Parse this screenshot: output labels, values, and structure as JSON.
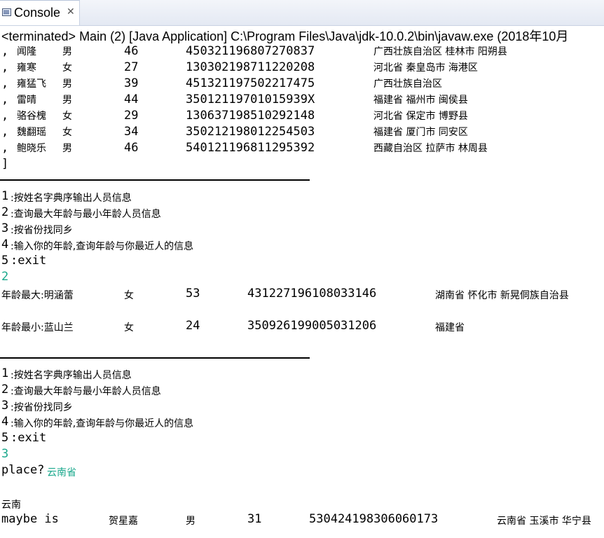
{
  "tab": {
    "label": "Console",
    "close": "✕",
    "icon": "console-icon"
  },
  "status_line": "<terminated> Main (2) [Java Application] C:\\Program Files\\Java\\jdk-10.0.2\\bin\\javaw.exe (2018年10月",
  "people": [
    {
      "prefix": ",",
      "name": "闻隆",
      "gender": "男",
      "age": "46",
      "id": "450321196807270837",
      "region": "广西壮族自治区 桂林市 阳朔县"
    },
    {
      "prefix": ",",
      "name": "雍寒",
      "gender": "女",
      "age": "27",
      "id": "130302198711220208",
      "region": "河北省 秦皇岛市 海港区"
    },
    {
      "prefix": ",",
      "name": "雍猛飞",
      "gender": "男",
      "age": "39",
      "id": "451321197502217475",
      "region": "广西壮族自治区"
    },
    {
      "prefix": ",",
      "name": "雷晴",
      "gender": "男",
      "age": "44",
      "id": "35012119701015939X",
      "region": "福建省 福州市 闽侯县"
    },
    {
      "prefix": ",",
      "name": "骆谷槐",
      "gender": "女",
      "age": "29",
      "id": "130637198510292148",
      "region": "河北省 保定市 博野县"
    },
    {
      "prefix": ",",
      "name": "魏翻瑶",
      "gender": "女",
      "age": "34",
      "id": "350212198012254503",
      "region": "福建省 厦门市 同安区"
    },
    {
      "prefix": ",",
      "name": "鲍晓乐",
      "gender": "男",
      "age": "46",
      "id": "540121196811295392",
      "region": "西藏自治区 拉萨市 林周县"
    }
  ],
  "closing_bracket": "]",
  "menu1": [
    {
      "num": "1",
      "text": ":按姓名字典序输出人员信息"
    },
    {
      "num": "2",
      "text": ":查询最大年龄与最小年龄人员信息"
    },
    {
      "num": "3",
      "text": ":按省份找同乡"
    },
    {
      "num": "4",
      "text": ":输入你的年龄,查询年龄与你最近人的信息"
    },
    {
      "num": "5",
      "text": ":exit"
    }
  ],
  "input1": "2",
  "oldest": {
    "label": "年龄最大:明涵蕾",
    "gender": "女",
    "age": "53",
    "id": "431227196108033146",
    "region": "湖南省 怀化市 新晃侗族自治县"
  },
  "youngest": {
    "label": "年龄最小:蓝山兰",
    "gender": "女",
    "age": "24",
    "id": "350926199005031206",
    "region": "福建省"
  },
  "menu2": [
    {
      "num": "1",
      "text": ":按姓名字典序输出人员信息"
    },
    {
      "num": "2",
      "text": ":查询最大年龄与最小年龄人员信息"
    },
    {
      "num": "3",
      "text": ":按省份找同乡"
    },
    {
      "num": "4",
      "text": ":输入你的年龄,查询年龄与你最近人的信息"
    },
    {
      "num": "5",
      "text": ":exit"
    }
  ],
  "input2": "3",
  "place_prompt": "place?",
  "place_input": "云南省",
  "province": "云南",
  "match": {
    "prefix": "maybe is",
    "name": "贺星嘉",
    "gender": "男",
    "age": "31",
    "id": "530424198306060173",
    "region": "云南省 玉溪市 华宁县"
  }
}
